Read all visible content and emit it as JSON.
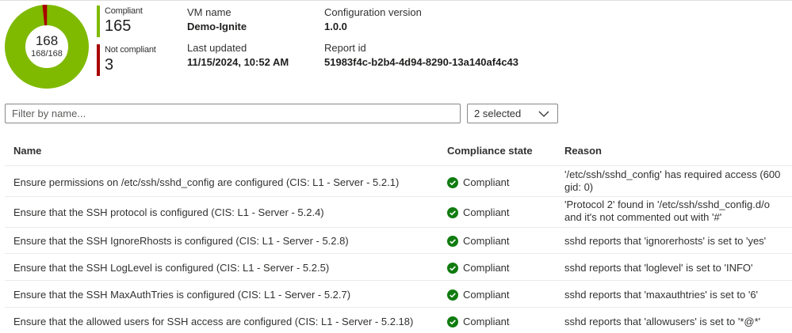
{
  "summary": {
    "total": "168",
    "ratio": "168/168",
    "compliant": {
      "label": "Compliant",
      "count": "165",
      "value": 165,
      "color": "#7fba00"
    },
    "not_compliant": {
      "label": "Not compliant",
      "count": "3",
      "value": 3,
      "color": "#a80000"
    }
  },
  "info": {
    "vm_name_label": "VM name",
    "vm_name": "Demo-Ignite",
    "config_version_label": "Configuration version",
    "config_version": "1.0.0",
    "last_updated_label": "Last updated",
    "last_updated": "11/15/2024, 10:52 AM",
    "report_id_label": "Report id",
    "report_id": "51983f4c-b2b4-4d94-8290-13a140af4c43"
  },
  "filter": {
    "placeholder": "Filter by name..."
  },
  "state_filter": {
    "selected": "2 selected"
  },
  "table": {
    "columns": [
      "Name",
      "Compliance state",
      "Reason"
    ],
    "rows": [
      {
        "name": "Ensure permissions on /etc/ssh/sshd_config are configured (CIS: L1 - Server - 5.2.1)",
        "state": "Compliant",
        "reason": "'/etc/ssh/sshd_config' has required access (600\ngid: 0)"
      },
      {
        "name": "Ensure that the SSH protocol is configured (CIS: L1 - Server - 5.2.4)",
        "state": "Compliant",
        "reason": "'Protocol 2' found in '/etc/ssh/sshd_config.d/o\nand it's not commented out with '#'"
      },
      {
        "name": "Ensure that the SSH IgnoreRhosts is configured (CIS: L1 - Server - 5.2.8)",
        "state": "Compliant",
        "reason": "sshd reports that 'ignorerhosts' is set to 'yes'"
      },
      {
        "name": "Ensure that the SSH LogLevel is configured (CIS: L1 - Server - 5.2.5)",
        "state": "Compliant",
        "reason": "sshd reports that 'loglevel' is set to 'INFO'"
      },
      {
        "name": "Ensure that the SSH MaxAuthTries is configured (CIS: L1 - Server - 5.2.7)",
        "state": "Compliant",
        "reason": "sshd reports that 'maxauthtries' is set to '6'"
      },
      {
        "name": "Ensure that the allowed users for SSH access are configured (CIS: L1 - Server - 5.2.18)",
        "state": "Compliant",
        "reason": "sshd reports that 'allowusers' is set to '*@*'"
      }
    ]
  },
  "icons": {
    "state": "check-circle-icon",
    "dropdown": "chevron-down-icon"
  },
  "colors": {
    "compliant": "#107c10",
    "border": "#8a8886"
  }
}
